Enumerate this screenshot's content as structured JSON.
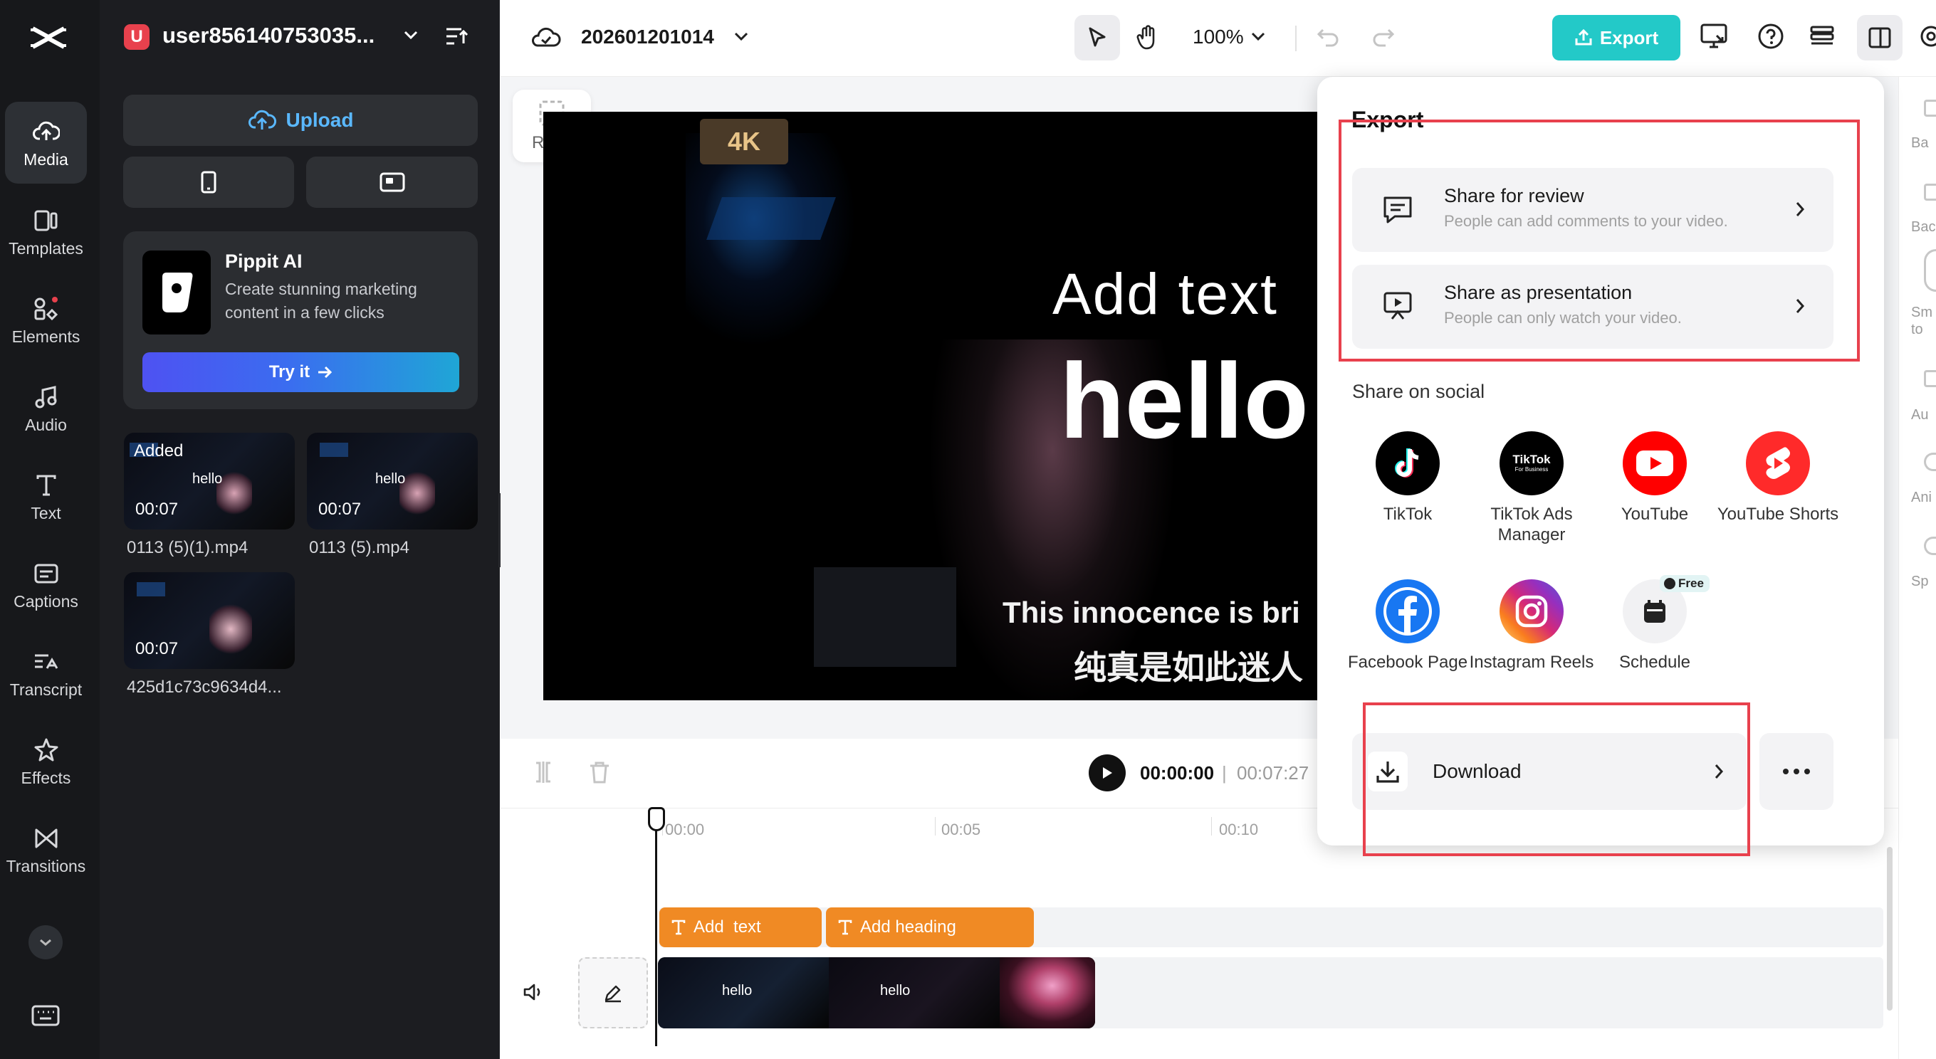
{
  "sidebar": {
    "items": [
      {
        "label": "Media",
        "icon": "cloud-upload-icon",
        "active": true
      },
      {
        "label": "Templates",
        "icon": "templates-icon"
      },
      {
        "label": "Elements",
        "icon": "elements-icon"
      },
      {
        "label": "Audio",
        "icon": "music-note-icon"
      },
      {
        "label": "Text",
        "icon": "text-icon"
      },
      {
        "label": "Captions",
        "icon": "captions-icon"
      },
      {
        "label": "Transcript",
        "icon": "transcript-icon"
      },
      {
        "label": "Effects",
        "icon": "effects-icon"
      },
      {
        "label": "Transitions",
        "icon": "transitions-icon"
      }
    ]
  },
  "user": {
    "initial": "U",
    "name": "user856140753035..."
  },
  "media": {
    "upload_label": "Upload",
    "promo": {
      "title": "Pippit AI",
      "desc": "Create stunning marketing content in a few clicks",
      "cta": "Try it"
    },
    "files": [
      {
        "badge": "Added",
        "duration": "00:07",
        "overlay": "hello",
        "name": "0113 (5)(1).mp4"
      },
      {
        "badge": "",
        "duration": "00:07",
        "overlay": "hello",
        "name": "0113 (5).mp4"
      },
      {
        "badge": "",
        "duration": "00:07",
        "overlay": "",
        "name": "425d1c73c9634d4..."
      }
    ]
  },
  "toolbar": {
    "project_name": "202601201014",
    "zoom": "100%",
    "export_label": "Export"
  },
  "canvas": {
    "ratio_label": "Ratio",
    "video_text": {
      "line1": "Add  text",
      "line2": "hello",
      "subtitle_en": "This innocence is bri",
      "subtitle_zh": "纯真是如此迷人",
      "badge": "4K"
    }
  },
  "right_strip": {
    "labels": [
      "Ba",
      "Bac",
      "Sm",
      "to",
      "Au",
      "Ani",
      "Sp"
    ]
  },
  "timeline": {
    "current_time": "00:00:00",
    "separator": "|",
    "total_time": "00:07:27",
    "ticks": [
      "00:00",
      "00:05",
      "00:10"
    ],
    "text_clips": [
      "Add  text",
      "Add heading"
    ],
    "video_overlays": [
      "hello",
      "hello"
    ]
  },
  "export_dialog": {
    "title": "Export",
    "options": [
      {
        "title": "Share for review",
        "desc": "People can add comments to your video.",
        "icon": "comment-icon"
      },
      {
        "title": "Share as presentation",
        "desc": "People can only watch your video.",
        "icon": "presentation-icon"
      }
    ],
    "social_label": "Share on social",
    "social": [
      {
        "name": "TikTok",
        "icon": "tiktok-icon",
        "color": "#000000"
      },
      {
        "name": "TikTok Ads Manager",
        "icon": "tiktok-business-icon",
        "color": "#000000",
        "logo_text": "TikTok",
        "logo_sub": "For Business"
      },
      {
        "name": "YouTube",
        "icon": "youtube-icon",
        "color": "#ff0000"
      },
      {
        "name": "YouTube Shorts",
        "icon": "youtube-shorts-icon",
        "color": "#ff2a2a"
      },
      {
        "name": "Facebook Page",
        "icon": "facebook-icon",
        "color": "#1877f2"
      },
      {
        "name": "Instagram Reels",
        "icon": "instagram-icon",
        "color": "#dd2a7b"
      },
      {
        "name": "Schedule",
        "icon": "calendar-icon",
        "color": "#f1f1f3",
        "badge": "Free"
      }
    ],
    "download_label": "Download"
  },
  "colors": {
    "accent": "#23c9c8",
    "highlight_box": "#e8414d",
    "text_clip": "#f08a24"
  }
}
